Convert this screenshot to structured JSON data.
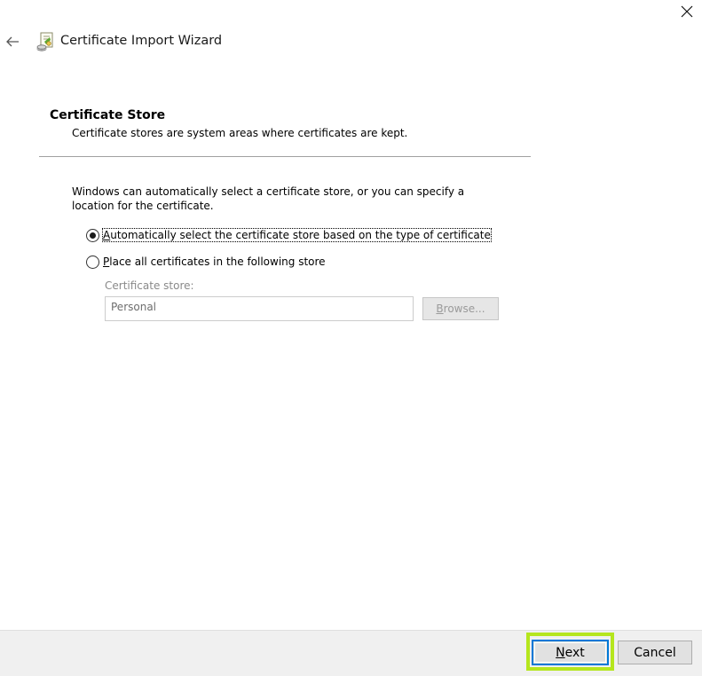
{
  "window": {
    "close_icon": "close-icon",
    "back_icon": "back-arrow-icon",
    "app_icon": "certificate-icon",
    "title": "Certificate Import Wizard"
  },
  "section": {
    "title": "Certificate Store",
    "description": "Certificate stores are system areas where certificates are kept."
  },
  "content": {
    "intro": "Windows can automatically select a certificate store, or you can specify a location for the certificate.",
    "options": [
      {
        "access_key": "A",
        "rest": "utomatically select the certificate store based on the type of certificate",
        "checked": true
      },
      {
        "access_key": "P",
        "rest": "lace all certificates in the following store",
        "checked": false
      }
    ],
    "store_label": "Certificate store:",
    "store_value": "Personal",
    "browse_access_key": "B",
    "browse_rest": "rowse..."
  },
  "footer": {
    "next_access_key": "N",
    "next_rest": "ext",
    "cancel_label": "Cancel"
  },
  "colors": {
    "focus_border": "#0078d7",
    "highlight": "#b5e61d",
    "footer_bg": "#f0f0f0"
  }
}
